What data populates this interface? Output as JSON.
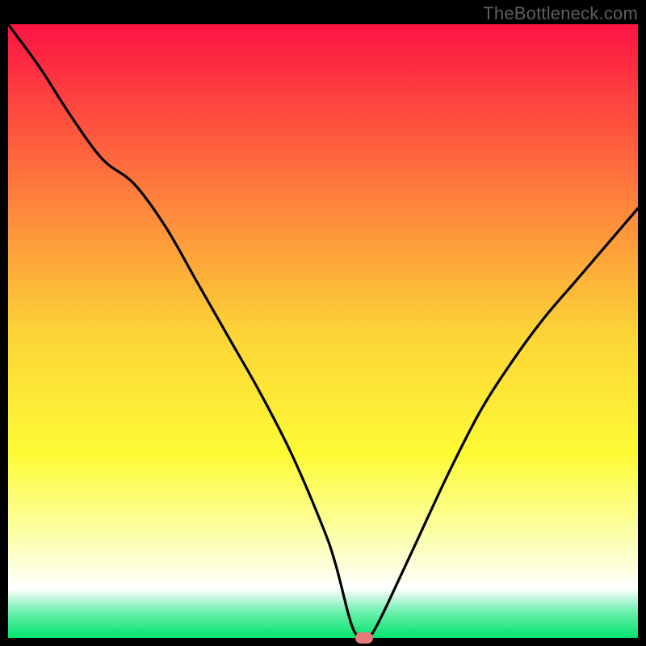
{
  "watermark": "TheBottleneck.com",
  "colors": {
    "gradient_top": "#fc1342",
    "gradient_mid1": "#fe7f3c",
    "gradient_mid2": "#fcd337",
    "gradient_yellow": "#fdfb35",
    "gradient_pale": "#fbffb0",
    "gradient_white": "#ffffff",
    "gradient_teal": "#75f0b2",
    "gradient_bottom": "#00e46c",
    "curve": "#000000",
    "marker": "#e87a77",
    "frame": "#000000"
  },
  "chart_data": {
    "type": "line",
    "title": "",
    "xlabel": "",
    "ylabel": "",
    "xlim": [
      0,
      100
    ],
    "ylim": [
      0,
      100
    ],
    "grid": false,
    "legend": false,
    "series": [
      {
        "name": "bottleneck-curve",
        "x": [
          0,
          5,
          10,
          15,
          20,
          25,
          30,
          35,
          40,
          45,
          50,
          52,
          54,
          55,
          56,
          57,
          58,
          60,
          65,
          70,
          75,
          80,
          85,
          90,
          95,
          100
        ],
        "y": [
          100,
          93,
          85,
          78,
          74,
          67,
          58,
          49,
          40,
          30,
          18,
          12,
          4,
          1,
          0,
          0,
          1,
          5,
          16,
          27,
          37,
          45,
          52,
          58,
          64,
          70
        ]
      }
    ],
    "marker": {
      "x": 56.5,
      "y": 0
    },
    "background_gradient": {
      "stops": [
        {
          "offset": 0.0,
          "color": "#fc1342"
        },
        {
          "offset": 0.28,
          "color": "#fe7f3c"
        },
        {
          "offset": 0.5,
          "color": "#fcd337"
        },
        {
          "offset": 0.7,
          "color": "#fdfb35"
        },
        {
          "offset": 0.84,
          "color": "#fbffb0"
        },
        {
          "offset": 0.92,
          "color": "#ffffff"
        },
        {
          "offset": 0.955,
          "color": "#75f0b2"
        },
        {
          "offset": 1.0,
          "color": "#00e46c"
        }
      ]
    }
  }
}
